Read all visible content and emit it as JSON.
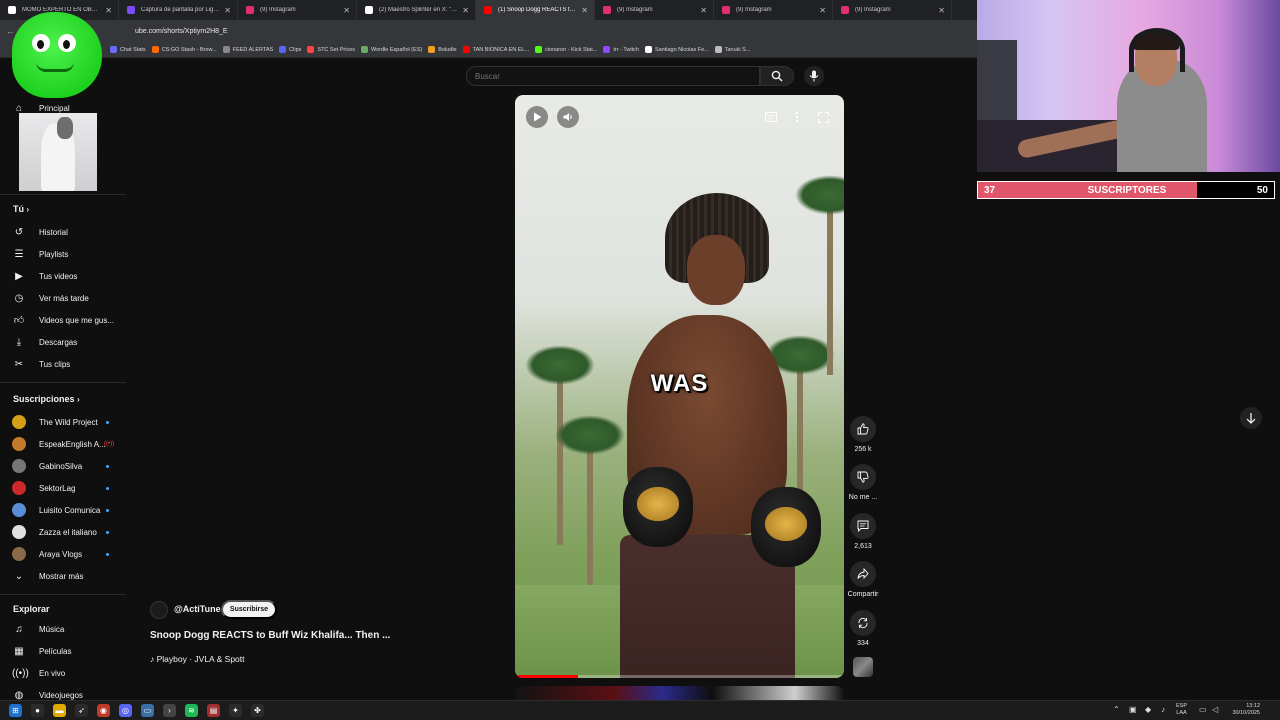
{
  "browser": {
    "tabs": [
      {
        "label": "MOMO EXPERTO EN OBRAS #...",
        "favicon_color": "#ffffff",
        "active": false
      },
      {
        "label": "Captura de pantalla por Lightsh...",
        "favicon_color": "#7c4dff",
        "active": false
      },
      {
        "label": "(9) Instagram",
        "favicon_color": "#e1306c",
        "active": false
      },
      {
        "label": "(2) Maestro Splinter en X: \"JAJA...",
        "favicon_color": "#ffffff",
        "active": false
      },
      {
        "label": "(1) Snoop Dogg REACTS to...",
        "favicon_color": "#ff0000",
        "active": true
      },
      {
        "label": "(9) Instagram",
        "favicon_color": "#e1306c",
        "active": false
      },
      {
        "label": "(9) Instagram",
        "favicon_color": "#e1306c",
        "active": false
      },
      {
        "label": "(9) Instagram",
        "favicon_color": "#e1306c",
        "active": false
      }
    ],
    "url": "ube.com/shorts/Xptiym2H8_E",
    "bookmarks": [
      {
        "label": "Chat Stats",
        "color": "#6b6bff"
      },
      {
        "label": "CS:GO Stash - Brow...",
        "color": "#ff6a00"
      },
      {
        "label": "FEED ALERTAS",
        "color": "#888888"
      },
      {
        "label": "Clips",
        "color": "#5865f2"
      },
      {
        "label": "STC Set Prices",
        "color": "#ff4444"
      },
      {
        "label": "Wordle Español (ES)",
        "color": "#6aaa64"
      },
      {
        "label": "Boludle",
        "color": "#f0a020"
      },
      {
        "label": "TAN BIONICA EN EL...",
        "color": "#ff0000"
      },
      {
        "label": "cionaron - Kick Stat...",
        "color": "#53fc18"
      },
      {
        "label": "trr - Twitch",
        "color": "#9146ff"
      },
      {
        "label": "Santiago Nicolas Fe...",
        "color": "#ffffff"
      },
      {
        "label": "Tanuki S...",
        "color": "#bbbbbb"
      }
    ]
  },
  "youtube": {
    "search_placeholder": "Buscar",
    "sidebar": {
      "top": [
        {
          "label": "Principal",
          "icon": "home-icon"
        }
      ],
      "you_header": "Tú",
      "you_items": [
        {
          "label": "Historial",
          "icon": "history-icon"
        },
        {
          "label": "Playlists",
          "icon": "playlists-icon"
        },
        {
          "label": "Tus videos",
          "icon": "your-videos-icon"
        },
        {
          "label": "Ver más tarde",
          "icon": "watch-later-icon"
        },
        {
          "label": "Videos que me gus...",
          "icon": "liked-videos-icon"
        },
        {
          "label": "Descargas",
          "icon": "downloads-icon"
        },
        {
          "label": "Tus clips",
          "icon": "clips-icon"
        }
      ],
      "subs_header": "Suscripciones",
      "subscriptions": [
        {
          "label": "The Wild Project",
          "color": "#d4a017",
          "badge": "dot"
        },
        {
          "label": "EspeakEnglish A...",
          "color": "#c47a2c",
          "badge": "live"
        },
        {
          "label": "GabinoSilva",
          "color": "#777777",
          "badge": "dot"
        },
        {
          "label": "SektorLag",
          "color": "#cc2a2a",
          "badge": "dot"
        },
        {
          "label": "Luisito Comunica",
          "color": "#5a8fd8",
          "badge": "dot"
        },
        {
          "label": "Zazza el italiano",
          "color": "#e0e0e0",
          "badge": "dot"
        },
        {
          "label": "Araya Vlogs",
          "color": "#8a6a4a",
          "badge": "dot"
        }
      ],
      "show_more": "Mostrar más",
      "explore_header": "Explorar",
      "explore_items": [
        {
          "label": "Música",
          "icon": "music-icon"
        },
        {
          "label": "Películas",
          "icon": "movies-icon"
        },
        {
          "label": "En vivo",
          "icon": "live-icon"
        },
        {
          "label": "Videojuegos",
          "icon": "gaming-icon"
        }
      ]
    },
    "short": {
      "caption": "WAS",
      "progress_fraction": 0.19,
      "channel": "@ActiTune",
      "subscribe_label": "Suscribirse",
      "title": "Snoop Dogg REACTS to Buff Wiz Khalifa... Then ...",
      "music": "♪ Playboy · JVLA & Spott",
      "actions": {
        "likes": "256 k",
        "dislike_label": "No me ...",
        "comments": "2,613",
        "share_label": "Compartir",
        "remixes": "334"
      }
    }
  },
  "stream_overlay": {
    "subs_current": "37",
    "subs_label": "SUSCRIPTORES",
    "subs_goal": "50",
    "subs_progress": 0.74,
    "bar_color": "#e0566b"
  },
  "taskbar": {
    "lang_line1": "ESP",
    "lang_line2": "LAA",
    "time": "13:12",
    "date": "30/10/2025"
  }
}
